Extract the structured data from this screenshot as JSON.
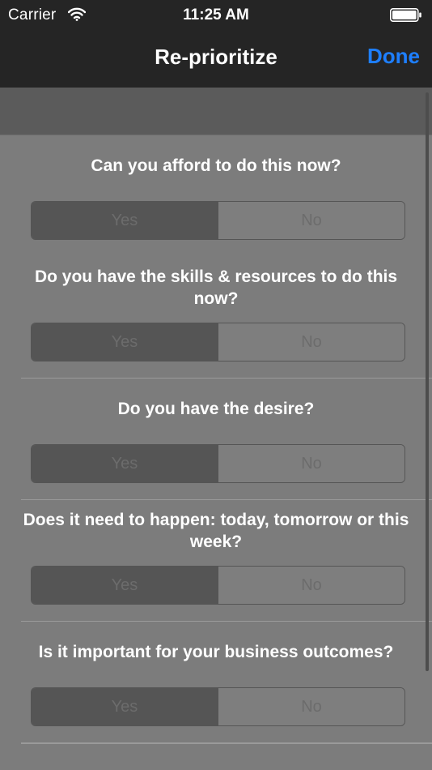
{
  "status_bar": {
    "carrier": "Carrier",
    "time": "11:25 AM"
  },
  "nav": {
    "title": "Re-prioritize",
    "done_label": "Done"
  },
  "questions": [
    {
      "text": "Can you afford to do this now?",
      "yes": "Yes",
      "no": "No",
      "selected": "Yes"
    },
    {
      "text": "Do you have the skills & resources to do this now?",
      "yes": "Yes",
      "no": "No",
      "selected": "Yes"
    },
    {
      "text": "Do you have the desire?",
      "yes": "Yes",
      "no": "No",
      "selected": "Yes"
    },
    {
      "text": "Does it need to happen: today, tomorrow or this week?",
      "yes": "Yes",
      "no": "No",
      "selected": "Yes"
    },
    {
      "text": "Is it important for your business outcomes?",
      "yes": "Yes",
      "no": "No",
      "selected": "Yes"
    }
  ],
  "colors": {
    "accent": "#1e7fff",
    "nav_background": "#252525",
    "content_background": "#7c7c7c",
    "selected_segment": "#555555"
  }
}
